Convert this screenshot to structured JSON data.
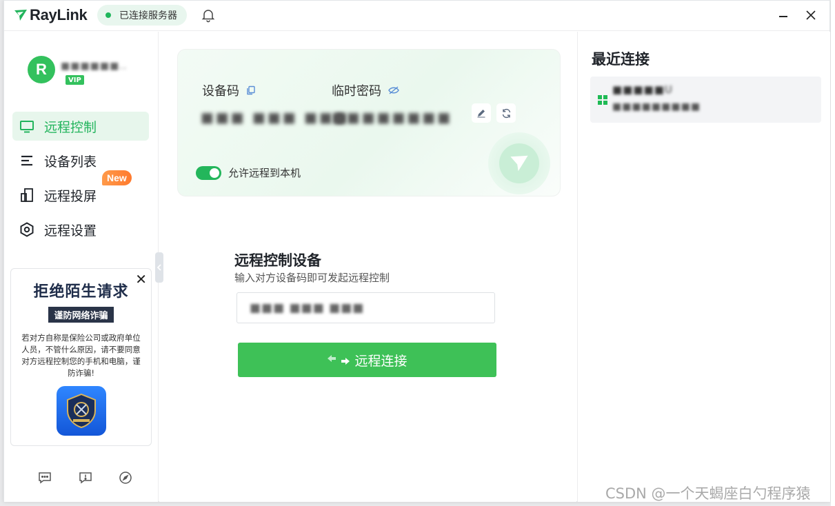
{
  "app": {
    "name": "RayLink",
    "connection_status": "已连接服务器",
    "accent_color": "#3ec157"
  },
  "user": {
    "avatar_letter": "R",
    "name": "■■■■■■..",
    "badge": "VIP"
  },
  "sidebar": {
    "items": [
      {
        "label": "远程控制",
        "icon": "monitor-icon",
        "active": true
      },
      {
        "label": "设备列表",
        "icon": "list-icon"
      },
      {
        "label": "远程投屏",
        "icon": "screen-cast-icon",
        "badge": "New"
      },
      {
        "label": "远程设置",
        "icon": "settings-hex-icon"
      }
    ],
    "footer_icons": [
      "chat-icon",
      "feedback-icon",
      "compass-icon"
    ]
  },
  "ad": {
    "title": "拒绝陌生请求",
    "subtitle": "谨防网络诈骗",
    "body": "若对方自称是保险公司或政府单位人员，不管什么原因，请不要同意对方远程控制您的手机和电脑，谨防诈骗!"
  },
  "device_card": {
    "device_code_label": "设备码",
    "device_code_value": "■■■ ■■■ ■■■",
    "temp_password_label": "临时密码",
    "temp_password_value": "■■■■■■■■",
    "allow_remote_label": "允许远程到本机",
    "allow_remote_enabled": true
  },
  "remote_control": {
    "title": "远程控制设备",
    "description": "输入对方设备码即可发起远程控制",
    "input_value": "■■■ ■■■ ■■■",
    "connect_button": "远程连接"
  },
  "recent": {
    "title": "最近连接",
    "items": [
      {
        "name": "■■■■■U",
        "code": "■■■■■■■■■",
        "os_icon": "windows-icon"
      }
    ]
  },
  "watermark": "CSDN @一个天蝎座白勺程序猿"
}
